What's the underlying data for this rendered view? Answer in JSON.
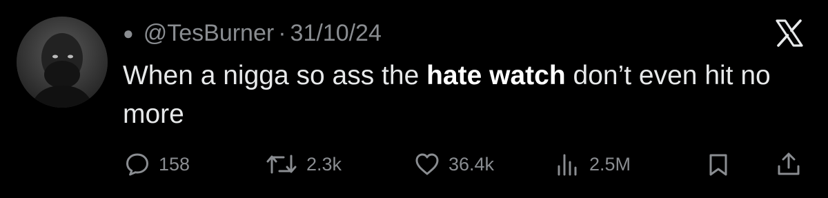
{
  "tweet": {
    "handle": "@TesBurner",
    "separator": "·",
    "date": "31/10/24",
    "text_part1": "When a nigga so ass the ",
    "text_bold": "hate watch",
    "text_part2": " don’t even hit no more"
  },
  "actions": {
    "replies": "158",
    "reposts": "2.3k",
    "likes": "36.4k",
    "views": "2.5M"
  },
  "icons": {
    "reply": "reply-icon",
    "repost": "repost-icon",
    "like": "heart-icon",
    "views": "views-icon",
    "bookmark": "bookmark-icon",
    "share": "share-icon",
    "logo": "x-logo-icon"
  },
  "colors": {
    "background": "#000000",
    "text": "#e7e9ea",
    "muted": "#8a8d91"
  }
}
